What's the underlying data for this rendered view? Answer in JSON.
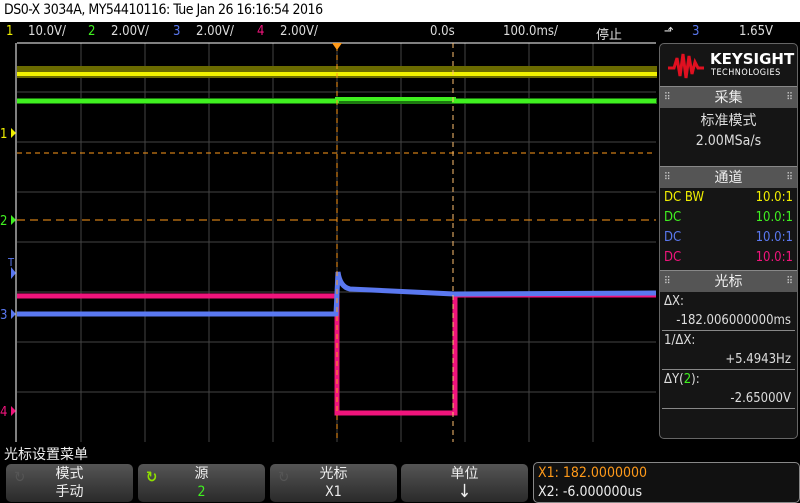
{
  "title": "DS0-X 3034A, MY54410116: Tue Jan 26 16:16:54 2016",
  "status": {
    "ch1": {
      "num": "1",
      "scale": "10.0V/"
    },
    "ch2": {
      "num": "2",
      "scale": "2.00V/"
    },
    "ch3": {
      "num": "3",
      "scale": "2.00V/"
    },
    "ch4": {
      "num": "4",
      "scale": "2.00V/"
    },
    "time_offset": "0.0s",
    "time_scale": "100.0ms/",
    "run_state": "停止",
    "trigger_source": "3",
    "trigger_level": "1.65V"
  },
  "colors": {
    "ch1": "#f0f000",
    "ch2": "#40f020",
    "ch3": "#5a78f0",
    "ch4": "#f0147c",
    "cursor": "#ff9a1a"
  },
  "channel_markers": {
    "ch1": "1",
    "ch2": "2",
    "ch3": "3",
    "ch4": "4",
    "trigger": "T"
  },
  "panel": {
    "logo_top": "KEYSIGHT",
    "logo_bottom": "TECHNOLOGIES",
    "acquire": {
      "header": "采集",
      "mode": "标准模式",
      "rate": "2.00MSa/s"
    },
    "channels": {
      "header": "通道",
      "rows": [
        {
          "coupling": "DC BW",
          "probe": "10.0:1"
        },
        {
          "coupling": "DC",
          "probe": "10.0:1"
        },
        {
          "coupling": "DC",
          "probe": "10.0:1"
        },
        {
          "coupling": "DC",
          "probe": "10.0:1"
        }
      ]
    },
    "cursors": {
      "header": "光标",
      "dx_label": "ΔX:",
      "dx_value": "-182.006000000ms",
      "inv_dx_label": "1/ΔX:",
      "inv_dx_value": "+5.4943Hz",
      "dy_label_pre": "ΔY(",
      "dy_channel": "2",
      "dy_label_post": "):",
      "dy_value": "-2.65000V"
    }
  },
  "menu": {
    "title": "光标设置菜单",
    "softkeys": [
      {
        "label": "模式",
        "value": "手动"
      },
      {
        "label": "源",
        "value": "2"
      },
      {
        "label": "光标",
        "value": "X1"
      },
      {
        "label": "单位",
        "value": "↓"
      }
    ],
    "x1": "X1: 182.0000000",
    "x2": "X2: -6.000000us"
  }
}
